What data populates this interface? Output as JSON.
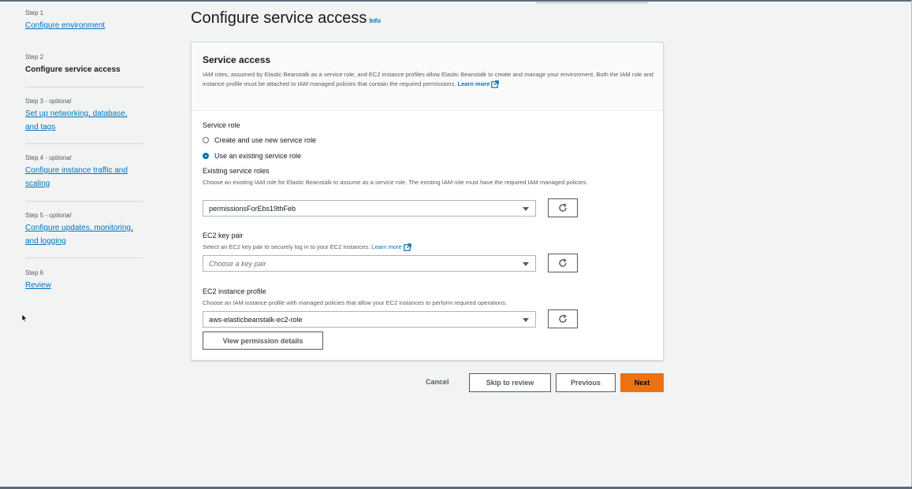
{
  "sidebar": {
    "steps": [
      {
        "num": "Step 1",
        "label": "Configure environment"
      },
      {
        "num": "Step 2",
        "label": "Configure service access"
      },
      {
        "num": "Step 3",
        "optional": "optional",
        "label_line1": "Set up networking, database,",
        "label_line2": "and tags"
      },
      {
        "num": "Step 4",
        "optional": "optional",
        "label_line1": "Configure instance traffic and",
        "label_line2": "scaling"
      },
      {
        "num": "Step 5",
        "optional": "optional",
        "label_line1": "Configure updates, monitoring,",
        "label_line2": "and logging"
      },
      {
        "num": "Step 6",
        "label": "Review"
      }
    ]
  },
  "header": {
    "title": "Configure service access",
    "info": "Info"
  },
  "panel": {
    "title": "Service access",
    "description": "IAM roles, assumed by Elastic Beanstalk as a service role, and EC2 instance profiles allow Elastic Beanstalk to create and manage your environment. Both the IAM role and instance profile must be attached to IAM managed policies that contain the required permissions.",
    "learn_more": "Learn more",
    "service_role": {
      "label": "Service role",
      "options": [
        "Create and use new service role",
        "Use an existing service role"
      ],
      "selected": 1
    },
    "existing_roles": {
      "label": "Existing service roles",
      "description": "Choose an existing IAM role for Elastic Beanstalk to assume as a service role. The existing IAM role must have the required IAM managed policies.",
      "value": "permissionsForEbs19thFeb"
    },
    "key_pair": {
      "label": "EC2 key pair",
      "description": "Select an EC2 key pair to securely log in to your EC2 instances.",
      "learn_more": "Learn more",
      "placeholder": "Choose a key pair"
    },
    "instance_profile": {
      "label": "EC2 instance profile",
      "description": "Choose an IAM instance profile with managed policies that allow your EC2 instances to perform required operations.",
      "value": "aws-elasticbeanstalk-ec2-role"
    },
    "view_permissions": "View permission details"
  },
  "footer": {
    "cancel": "Cancel",
    "skip": "Skip to review",
    "previous": "Previous",
    "next": "Next"
  },
  "colors": {
    "accent": "#0073bb",
    "primary": "#ec7211"
  }
}
